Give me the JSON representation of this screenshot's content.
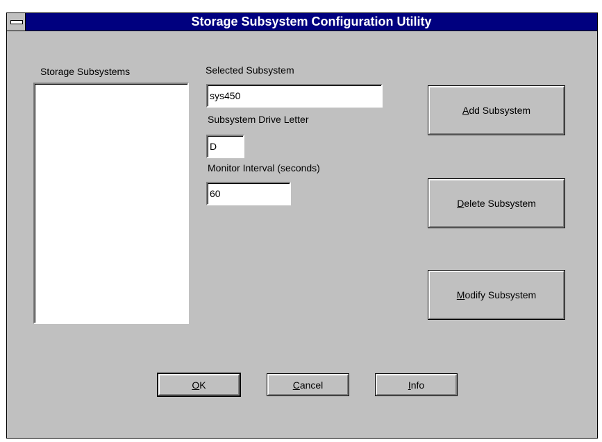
{
  "window": {
    "title": "Storage Subsystem Configuration Utility"
  },
  "subsystems_list": {
    "label": "Storage Subsystems",
    "items": []
  },
  "selected_subsystem": {
    "label": "Selected Subsystem",
    "value": "sys450"
  },
  "drive_letter": {
    "label": "Subsystem Drive Letter",
    "value": "D"
  },
  "monitor_interval": {
    "label": "Monitor Interval (seconds)",
    "value": "60"
  },
  "buttons": {
    "add": {
      "mnemonic": "A",
      "rest": "dd Subsystem"
    },
    "delete": {
      "mnemonic": "D",
      "rest": "elete Subsystem"
    },
    "modify": {
      "mnemonic": "M",
      "rest": "odify Subsystem"
    },
    "ok": {
      "mnemonic": "O",
      "rest": "K"
    },
    "cancel": {
      "mnemonic": "C",
      "rest": "ancel"
    },
    "info": {
      "mnemonic": "I",
      "rest": "nfo"
    }
  }
}
